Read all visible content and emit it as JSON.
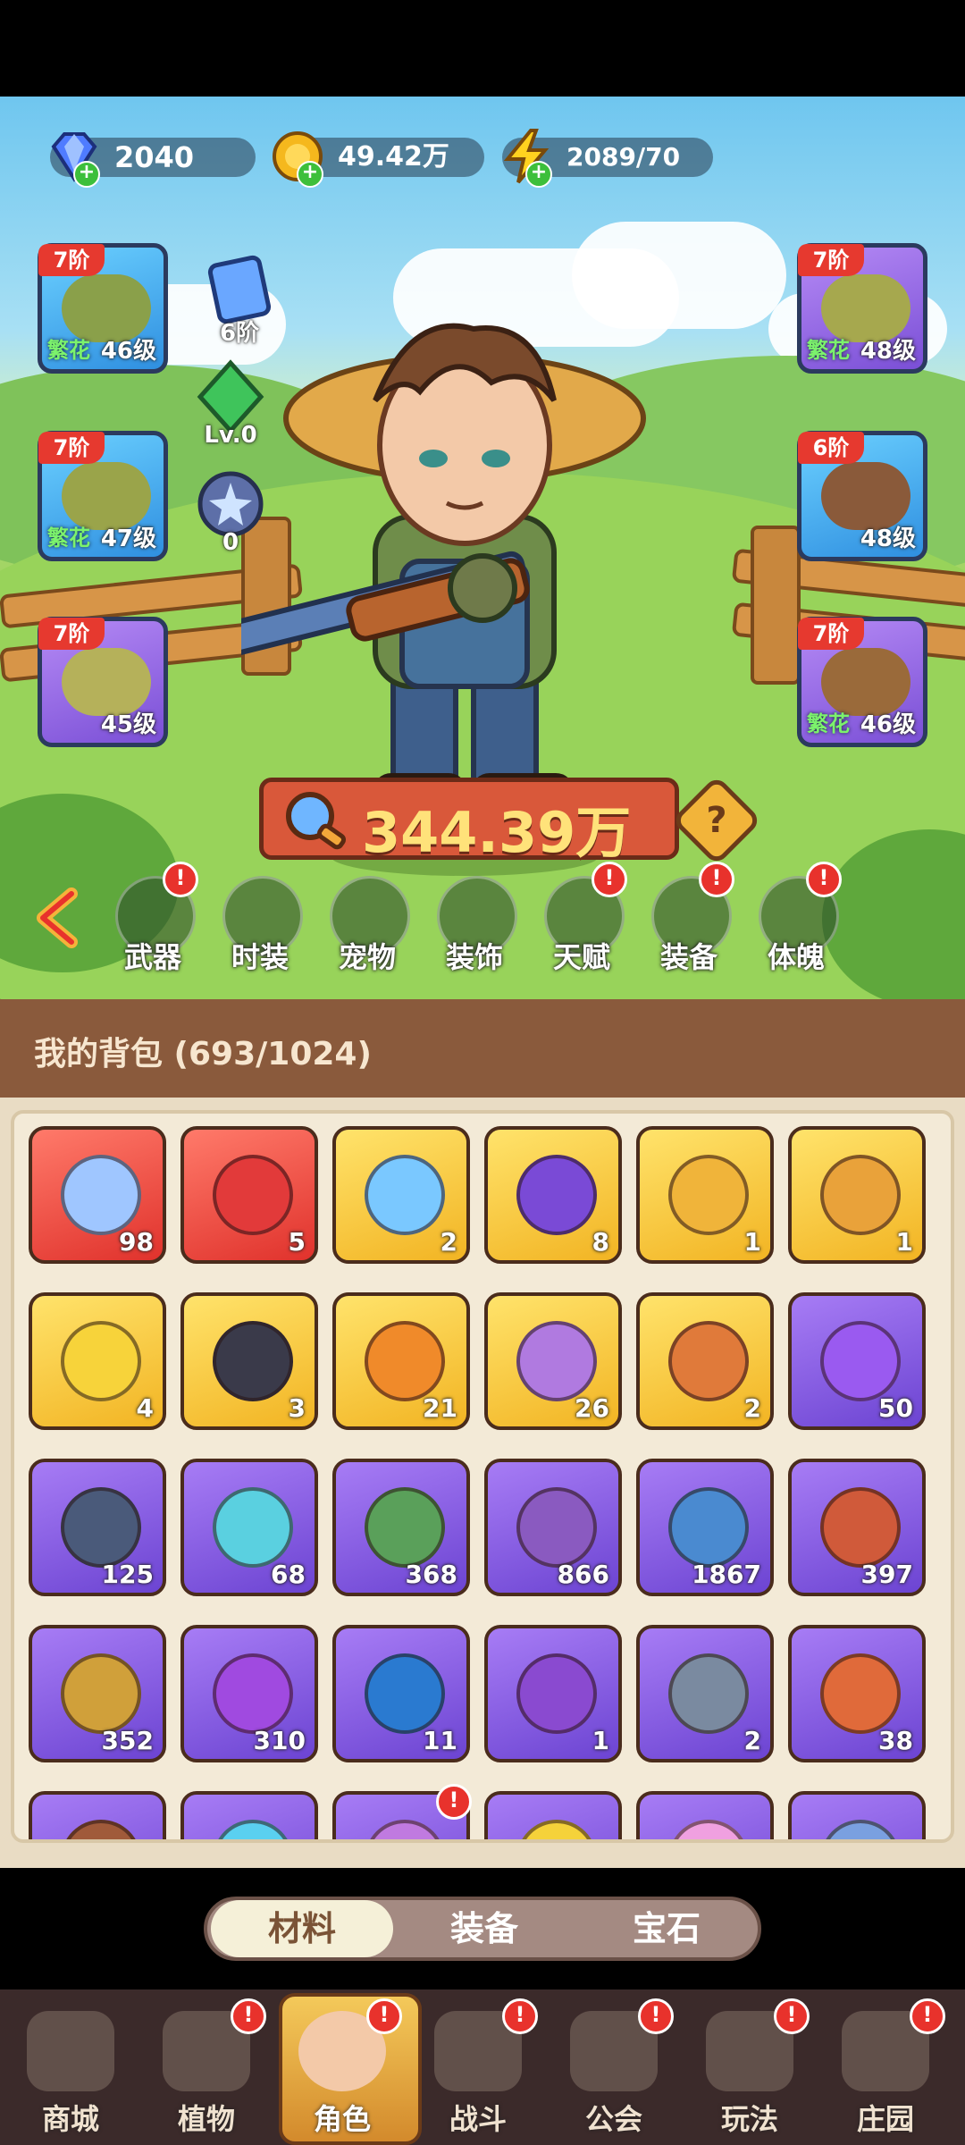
{
  "currencies": {
    "gems": "2040",
    "gold": "49.42万",
    "energy": "2089/70"
  },
  "equipment_left": [
    {
      "tier": "7阶",
      "level": "46级",
      "flower": "繁花",
      "frame": "blue"
    },
    {
      "tier": "7阶",
      "level": "47级",
      "flower": "繁花",
      "frame": "blue"
    },
    {
      "tier": "7阶",
      "level": "45级",
      "flower": "",
      "frame": "purple"
    }
  ],
  "equipment_right": [
    {
      "tier": "7阶",
      "level": "48级",
      "flower": "繁花",
      "frame": "purple"
    },
    {
      "tier": "6阶",
      "level": "48级",
      "flower": "",
      "frame": "blue"
    },
    {
      "tier": "7阶",
      "level": "46级",
      "flower": "繁花",
      "frame": "purple"
    }
  ],
  "mini_items": [
    {
      "label": "6阶",
      "icon": "card-icon"
    },
    {
      "label": "Lv.0",
      "icon": "green-crystal-icon"
    },
    {
      "label": "0",
      "icon": "star-orb-icon"
    }
  ],
  "power": "344.39万",
  "menu": [
    {
      "label": "武器",
      "badge": "!",
      "icon": "gun-icon"
    },
    {
      "label": "时装",
      "badge": "",
      "icon": "shirt-icon"
    },
    {
      "label": "宠物",
      "badge": "",
      "icon": "cat-icon"
    },
    {
      "label": "装饰",
      "badge": "",
      "icon": "mask-icon"
    },
    {
      "label": "天赋",
      "badge": "!",
      "icon": "talent-icon"
    },
    {
      "label": "装备",
      "badge": "!",
      "icon": "hammer-icon"
    },
    {
      "label": "体魄",
      "badge": "!",
      "icon": "spirit-icon"
    }
  ],
  "bag": {
    "title": "我的背包 (693/1024)",
    "items": [
      {
        "count": "98",
        "frame": "red",
        "icon": "crystal-star-icon"
      },
      {
        "count": "5",
        "frame": "red",
        "icon": "red-potion-icon"
      },
      {
        "count": "2",
        "frame": "gold",
        "icon": "water-drop-icon"
      },
      {
        "count": "8",
        "frame": "gold",
        "icon": "skull-book-icon"
      },
      {
        "count": "1",
        "frame": "gold",
        "icon": "gold-key-icon"
      },
      {
        "count": "1",
        "frame": "gold",
        "icon": "gem-key-icon"
      },
      {
        "count": "4",
        "frame": "gold",
        "icon": "golden-flower-icon"
      },
      {
        "count": "3",
        "frame": "gold",
        "icon": "rune-stone-icon"
      },
      {
        "count": "21",
        "frame": "gold",
        "icon": "orange-potion-icon"
      },
      {
        "count": "26",
        "frame": "gold",
        "icon": "spell-book-icon"
      },
      {
        "count": "2",
        "frame": "gold",
        "icon": "canned-food-icon"
      },
      {
        "count": "50",
        "frame": "purple",
        "icon": "purple-vial-icon"
      },
      {
        "count": "125",
        "frame": "purple",
        "icon": "lightning-badge-icon"
      },
      {
        "count": "68",
        "frame": "purple",
        "icon": "blue-leaf-icon"
      },
      {
        "count": "368",
        "frame": "purple",
        "icon": "green-scroll-icon"
      },
      {
        "count": "866",
        "frame": "purple",
        "icon": "purple-scroll-icon"
      },
      {
        "count": "1867",
        "frame": "purple",
        "icon": "blue-scroll-icon"
      },
      {
        "count": "397",
        "frame": "purple",
        "icon": "red-scroll-icon"
      },
      {
        "count": "352",
        "frame": "purple",
        "icon": "gold-scroll-icon"
      },
      {
        "count": "310",
        "frame": "purple",
        "icon": "purple-potion-icon"
      },
      {
        "count": "11",
        "frame": "purple",
        "icon": "blue-bulb-icon"
      },
      {
        "count": "1",
        "frame": "purple",
        "icon": "purple-bulb-icon"
      },
      {
        "count": "2",
        "frame": "purple",
        "icon": "watering-can-icon"
      },
      {
        "count": "38",
        "frame": "purple",
        "icon": "fruit-bowl-icon"
      },
      {
        "count": "",
        "frame": "purple",
        "icon": "nut-bowl-icon"
      },
      {
        "count": "",
        "frame": "purple",
        "icon": "puzzle-icon"
      },
      {
        "count": "",
        "frame": "purple",
        "icon": "scroll-ticket-icon",
        "badge": "!"
      },
      {
        "count": "",
        "frame": "purple",
        "icon": "gold-crystal-icon"
      },
      {
        "count": "",
        "frame": "purple",
        "icon": "pink-gem-icon"
      },
      {
        "count": "",
        "frame": "purple",
        "icon": "blue-gem-icon"
      }
    ]
  },
  "tabs": [
    {
      "label": "材料",
      "active": true
    },
    {
      "label": "装备",
      "active": false
    },
    {
      "label": "宝石",
      "active": false
    }
  ],
  "nav": [
    {
      "label": "商城",
      "badge": "",
      "active": false
    },
    {
      "label": "植物",
      "badge": "!",
      "active": false
    },
    {
      "label": "角色",
      "badge": "!",
      "active": true
    },
    {
      "label": "战斗",
      "badge": "!",
      "active": false
    },
    {
      "label": "公会",
      "badge": "!",
      "active": false
    },
    {
      "label": "玩法",
      "badge": "!",
      "active": false
    },
    {
      "label": "庄园",
      "badge": "!",
      "active": false
    }
  ],
  "colors": {
    "badge_red": "#e8322c",
    "rarity_red": "#e0322c",
    "rarity_gold": "#f2b423",
    "rarity_purple": "#6c44d2",
    "power_gold": "#ffe27a"
  }
}
